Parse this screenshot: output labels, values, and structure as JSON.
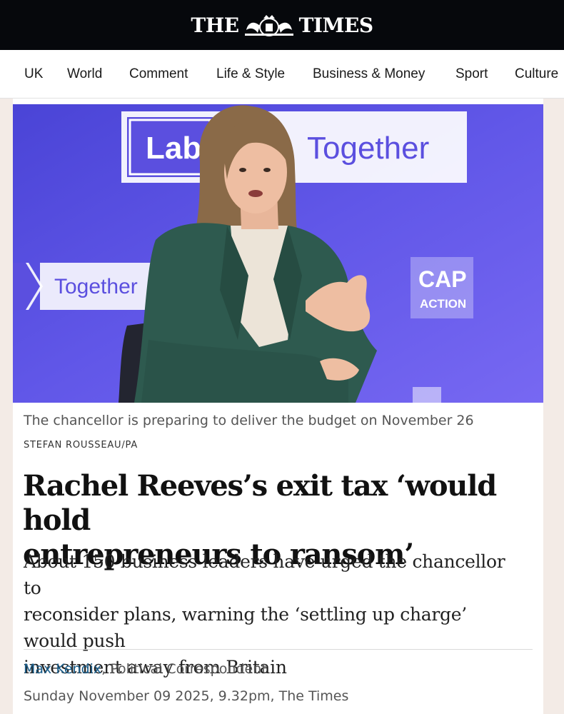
{
  "masthead": {
    "word_left": "THE",
    "word_right": "TIMES"
  },
  "nav": {
    "items": [
      "UK",
      "World",
      "Comment",
      "Life & Style",
      "Business & Money",
      "Sport",
      "Culture"
    ]
  },
  "photo": {
    "sign_top": "Lab",
    "sign_top_right": "Together",
    "sign_left": "Together",
    "sign_cap": "CAP",
    "sign_action": "ACTION"
  },
  "article": {
    "caption": "The chancellor is preparing to deliver the budget on November 26",
    "credit": "STEFAN ROUSSEAU/PA",
    "headline_line1": "Rachel Reeves’s exit tax ‘would hold",
    "headline_line2": "entrepreneurs to ransom’",
    "standfirst_line1": "About 150 business leaders have urged the chancellor to",
    "standfirst_line2": "reconsider plans, warning the ‘settling up charge’ would push",
    "standfirst_line3": "investment away from Britain",
    "author": "Max Kendix",
    "author_role": ", Political Correspondent",
    "dateline": "Sunday November 09 2025, 9.32pm, The Times"
  },
  "colors": {
    "masthead_bg": "#06080c",
    "link": "#1b5f8c",
    "photo_bg": "#5b4fdf"
  }
}
